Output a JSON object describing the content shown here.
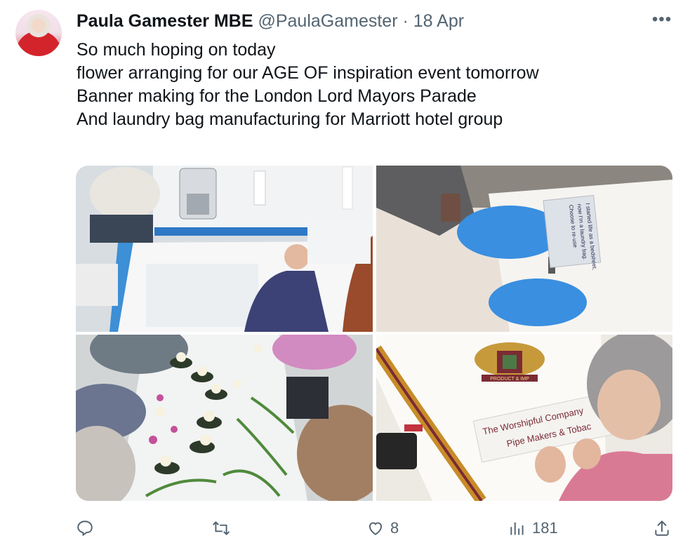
{
  "author": {
    "name": "Paula Gamester MBE",
    "handle": "@PaulaGamester",
    "separator": "·",
    "date": "18 Apr"
  },
  "more_icon": "more-horizontal-icon",
  "tweet": {
    "lines": [
      "So much hoping on today",
      "flower arranging for our AGE OF inspiration  event tomorrow",
      "Banner making for the London Lord Mayors Parade",
      "And laundry bag manufacturing  for Marriott hotel group"
    ]
  },
  "media": {
    "photos": [
      {
        "name": "sewing-workshop-photo"
      },
      {
        "name": "laundry-bag-label-photo"
      },
      {
        "name": "flower-arranging-photo"
      },
      {
        "name": "banner-making-photo",
        "banner_text": [
          "PRODUCT & IMP",
          "The Worshipful Company",
          "Pipe Makers & Tobac"
        ],
        "label_text": [
          "I started life as a bedsheet,",
          "now I'm a laundry bag.",
          "Choose to re-use"
        ]
      }
    ]
  },
  "actions": {
    "reply": {
      "icon": "reply-icon",
      "count": ""
    },
    "retweet": {
      "icon": "retweet-icon",
      "count": ""
    },
    "like": {
      "icon": "heart-icon",
      "count": "8"
    },
    "views": {
      "icon": "views-icon",
      "count": "181"
    },
    "share": {
      "icon": "share-icon",
      "count": ""
    }
  },
  "colors": {
    "text": "#0f1419",
    "secondary": "#536471",
    "avatar_red": "#d4242b"
  }
}
